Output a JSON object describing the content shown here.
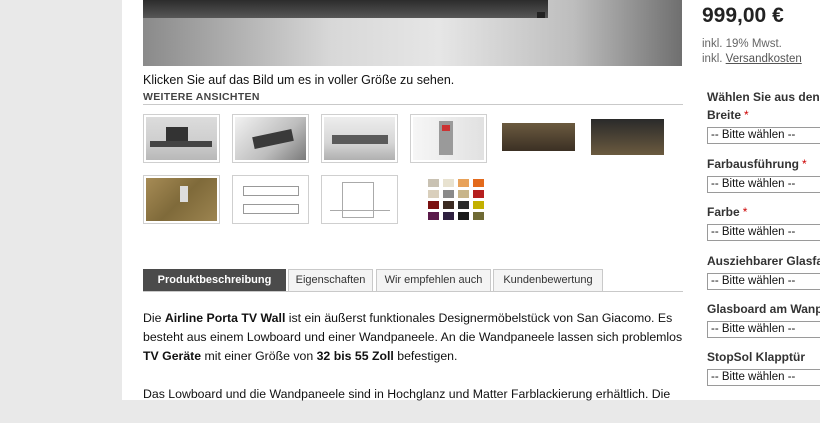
{
  "image": {
    "hint": "Klicken Sie auf das Bild um es in voller Größe zu sehen.",
    "more_views_title": "WEITERE ANSICHTEN"
  },
  "tabs": [
    {
      "label": "Produktbeschreibung",
      "active": true
    },
    {
      "label": "Eigenschaften",
      "active": false
    },
    {
      "label": "Wir empfehlen auch",
      "active": false
    },
    {
      "label": "Kundenbewertung",
      "active": false
    }
  ],
  "description": {
    "p1": [
      {
        "t": "Die ",
        "b": false
      },
      {
        "t": "Airline Porta TV Wall",
        "b": true
      },
      {
        "t": " ist ein äußerst funktionales Designermöbelstück von San Giacomo. Es besteht aus einem Lowboard und einer Wandpaneele. An die Wandpaneele lassen sich problemlos ",
        "b": false
      },
      {
        "t": "TV Geräte",
        "b": true
      },
      {
        "t": " mit einer Größe von ",
        "b": false
      },
      {
        "t": "32 bis 55 Zoll",
        "b": true
      },
      {
        "t": " befestigen.",
        "b": false
      }
    ],
    "p2": "Das Lowboard und die Wandpaneele sind in Hochglanz und Matter Farblackierung erhältlich. Die"
  },
  "price": {
    "amount": "999,00 €",
    "tax_line": "inkl. 19% Mwst.",
    "shipping_prefix": "inkl. ",
    "shipping_link": "Versandkosten"
  },
  "options": {
    "heading": "Wählen Sie aus den",
    "select_placeholder": "-- Bitte wählen --",
    "items": [
      {
        "label": "Breite",
        "required": true
      },
      {
        "label": "Farbausführung",
        "required": true
      },
      {
        "label": "Farbe",
        "required": true
      },
      {
        "label": "Ausziehbarer Glasfa",
        "required": false
      },
      {
        "label": "Glasboard am Wanp",
        "required": false
      },
      {
        "label": "StopSol Klapptür",
        "required": false
      }
    ]
  },
  "colors": {
    "tab_active_bg": "#4b4b4b",
    "required_star": "#cc0000"
  },
  "swatch_colors": [
    "#c9c2b3",
    "#e8e2d0",
    "#e8a25a",
    "#e36a1c",
    "#d9cfbc",
    "#8a8a8a",
    "#c8b58a",
    "#b51f1f",
    "#7a1010",
    "#3c2b22",
    "#2b2b2b",
    "#c3b000",
    "#5a1a4a",
    "#2e2040",
    "#1a1a1a",
    "#6f6a34"
  ]
}
